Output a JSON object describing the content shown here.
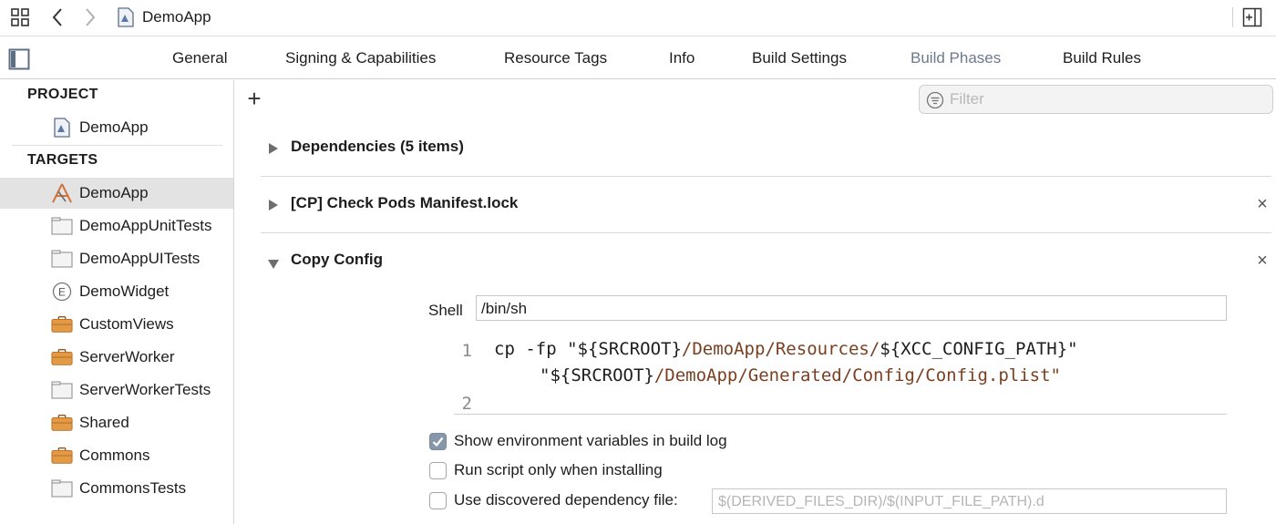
{
  "toolbar": {
    "title": "DemoApp"
  },
  "tabs": [
    {
      "label": "General"
    },
    {
      "label": "Signing & Capabilities"
    },
    {
      "label": "Resource Tags"
    },
    {
      "label": "Info"
    },
    {
      "label": "Build Settings"
    },
    {
      "label": "Build Phases",
      "active": true
    },
    {
      "label": "Build Rules"
    }
  ],
  "sidebar": {
    "project_header": "PROJECT",
    "project_item": "DemoApp",
    "targets_header": "TARGETS",
    "targets": [
      {
        "label": "DemoApp",
        "icon": "app-target-icon",
        "selected": true
      },
      {
        "label": "DemoAppUnitTests",
        "icon": "test-bundle-icon"
      },
      {
        "label": "DemoAppUITests",
        "icon": "test-bundle-icon"
      },
      {
        "label": "DemoWidget",
        "icon": "extension-icon"
      },
      {
        "label": "CustomViews",
        "icon": "framework-icon"
      },
      {
        "label": "ServerWorker",
        "icon": "framework-icon"
      },
      {
        "label": "ServerWorkerTests",
        "icon": "test-bundle-icon"
      },
      {
        "label": "Shared",
        "icon": "framework-icon"
      },
      {
        "label": "Commons",
        "icon": "framework-icon"
      },
      {
        "label": "CommonsTests",
        "icon": "test-bundle-icon"
      }
    ]
  },
  "main": {
    "add_symbol": "+",
    "filter_placeholder": "Filter",
    "phases": [
      {
        "title": "Dependencies (5 items)",
        "expanded": false
      },
      {
        "title": "[CP] Check Pods Manifest.lock",
        "expanded": false,
        "close": "×"
      },
      {
        "title": "Copy Config",
        "expanded": true,
        "close": "×"
      }
    ],
    "shell_label": "Shell",
    "shell_value": "/bin/sh",
    "code": {
      "line1_number": "1",
      "line1_cmd": "cp -fp ",
      "line1_q1": "\"${SRCROOT}",
      "line1_path1": "/DemoApp/Resources/",
      "line1_q2": "${XCC_CONFIG_PATH}\"",
      "line1b_q1": "\"${SRCROOT}",
      "line1b_path": "/DemoApp/Generated/Config/Config.plist\"",
      "line2_number": "2"
    },
    "options": {
      "show_env": {
        "label": "Show environment variables in build log",
        "checked": true
      },
      "run_install": {
        "label": "Run script only when installing",
        "checked": false
      },
      "dep_file": {
        "label": "Use discovered dependency file:",
        "checked": false,
        "placeholder": "$(DERIVED_FILES_DIR)/$(INPUT_FILE_PATH).d"
      }
    }
  },
  "colors": {
    "accent": "#8796a8",
    "string": "#7a3f20",
    "selection": "#e3e3e3"
  }
}
